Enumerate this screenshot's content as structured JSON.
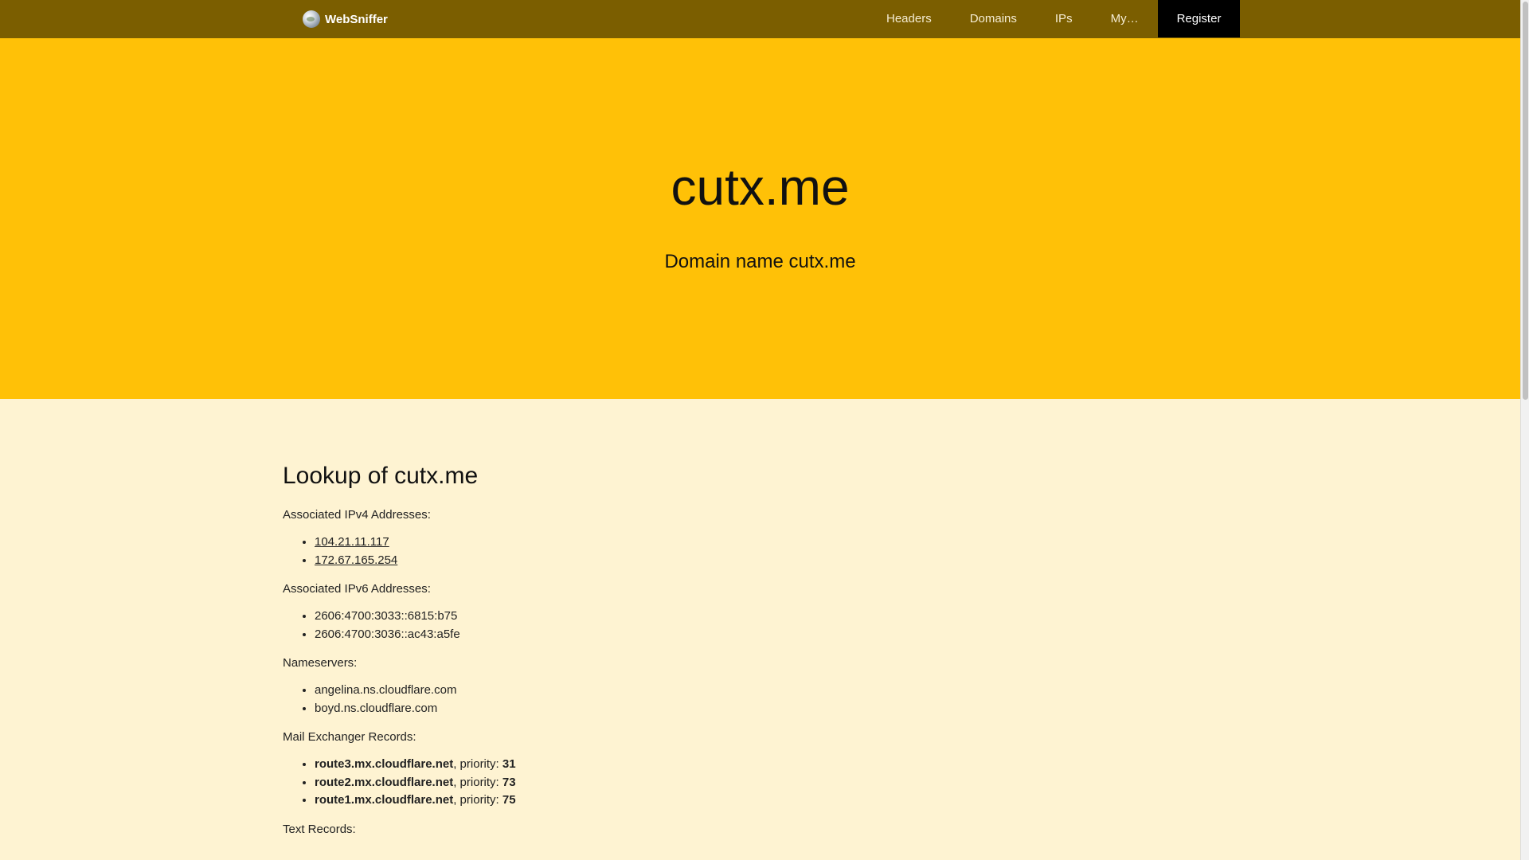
{
  "navbar": {
    "brand": "WebSniffer",
    "brand_icon": "globe-icon",
    "links": {
      "headers": "Headers",
      "domains": "Domains",
      "ips": "IPs",
      "my": "My…",
      "register": "Register"
    }
  },
  "hero": {
    "title": "cutx.me",
    "subtitle": "Domain name cutx.me"
  },
  "lookup": {
    "heading": "Lookup of cutx.me",
    "ipv4": {
      "label": "Associated IPv4 Addresses:",
      "items": [
        "104.21.11.117",
        "172.67.165.254"
      ]
    },
    "ipv6": {
      "label": "Associated IPv6 Addresses:",
      "items": [
        "2606:4700:3033::6815:b75",
        "2606:4700:3036::ac43:a5fe"
      ]
    },
    "nameservers": {
      "label": "Nameservers:",
      "items": [
        "angelina.ns.cloudflare.com",
        "boyd.ns.cloudflare.com"
      ]
    },
    "mx": {
      "label": "Mail Exchanger Records:",
      "priority_label": ", priority: ",
      "items": [
        {
          "host": "route3.mx.cloudflare.net",
          "priority": "31"
        },
        {
          "host": "route2.mx.cloudflare.net",
          "priority": "73"
        },
        {
          "host": "route1.mx.cloudflare.net",
          "priority": "75"
        }
      ]
    },
    "txt": {
      "label": "Text Records:"
    }
  },
  "colors": {
    "navbar": "#7B5E00",
    "hero": "#FFC107",
    "page_bg": "#FEF3D2",
    "register_bg": "#000000"
  }
}
